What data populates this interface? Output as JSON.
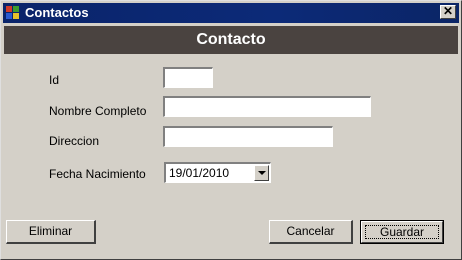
{
  "window": {
    "title": "Contactos"
  },
  "header": {
    "title": "Contacto"
  },
  "form": {
    "id_label": "Id",
    "id_value": "",
    "nombre_label": "Nombre Completo",
    "nombre_value": "",
    "direccion_label": "Direccion",
    "direccion_value": "",
    "fecha_label": "Fecha Nacimiento",
    "fecha_value": "19/01/2010"
  },
  "buttons": {
    "eliminar": "Eliminar",
    "cancelar": "Cancelar",
    "guardar": "Guardar"
  },
  "icons": {
    "app": "windows-form-icon",
    "close": "close-icon",
    "dropdown": "chevron-down-icon"
  },
  "colors": {
    "titlebar": "#0a246a",
    "header_band": "#4a4340",
    "window_bg": "#d4d0c8"
  }
}
